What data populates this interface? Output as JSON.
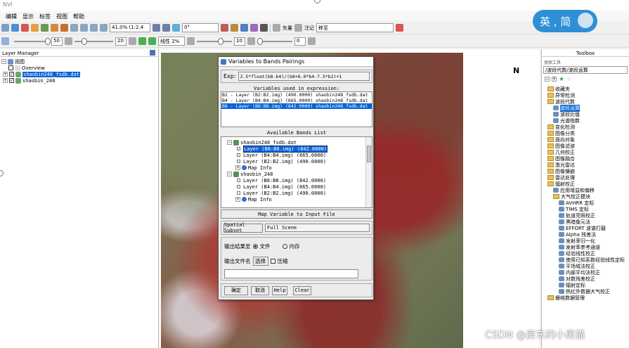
{
  "window": {
    "title": "NVI"
  },
  "menu": [
    "编辑",
    "显示",
    "标签",
    "视图",
    "帮助"
  ],
  "toolbar1": {
    "zoom": "41.0% (1:2.4",
    "rotation": "0°",
    "vector_label": "矢量",
    "annotation_label": "注记",
    "annotation_value": "移至"
  },
  "toolbar2": {
    "v1": "50",
    "v2": "20",
    "stretch": "线性 2%",
    "v3": "10",
    "v4": "0"
  },
  "ime": {
    "label": "英 , 简"
  },
  "layer_manager": {
    "title": "Layer Manager",
    "root": "视图",
    "items": [
      "Overview",
      "shaobin248_fsdb.dat",
      "shaobin_248"
    ]
  },
  "north_arrow": "N",
  "toolbox": {
    "title": "Toolbox",
    "path": "/波段代数/波段运算",
    "search_label": "搜索工具",
    "items": [
      {
        "label": "收藏夹",
        "level": 0,
        "icon": "folder"
      },
      {
        "label": "异常检测",
        "level": 0,
        "icon": "folder"
      },
      {
        "label": "波段代数",
        "level": 0,
        "icon": "folder"
      },
      {
        "label": "波段运算",
        "level": 1,
        "icon": "tool",
        "selected": true
      },
      {
        "label": "波段比值",
        "level": 1,
        "icon": "tool"
      },
      {
        "label": "光谱指数",
        "level": 1,
        "icon": "tool"
      },
      {
        "label": "变化检测",
        "level": 0,
        "icon": "folder"
      },
      {
        "label": "图像分类",
        "level": 0,
        "icon": "folder"
      },
      {
        "label": "面向对象",
        "level": 0,
        "icon": "folder"
      },
      {
        "label": "图像滤波",
        "level": 0,
        "icon": "folder"
      },
      {
        "label": "几何校正",
        "level": 0,
        "icon": "folder"
      },
      {
        "label": "图像融合",
        "level": 0,
        "icon": "folder"
      },
      {
        "label": "激光雷达",
        "level": 0,
        "icon": "folder"
      },
      {
        "label": "图像镶嵌",
        "level": 0,
        "icon": "folder"
      },
      {
        "label": "雷达处理",
        "level": 0,
        "icon": "folder"
      },
      {
        "label": "辐射校正",
        "level": 0,
        "icon": "folder"
      },
      {
        "label": "应用增益和偏移",
        "level": 1,
        "icon": "tool"
      },
      {
        "label": "大气校正模块",
        "level": 1,
        "icon": "folder"
      },
      {
        "label": "AVHRR 定标",
        "level": 2,
        "icon": "tool"
      },
      {
        "label": "TIMS 定标",
        "level": 2,
        "icon": "tool"
      },
      {
        "label": "轨道亮照校正",
        "level": 2,
        "icon": "tool"
      },
      {
        "label": "黑暗像元法",
        "level": 2,
        "icon": "tool"
      },
      {
        "label": "EFFORT 波谱打磨",
        "level": 2,
        "icon": "tool"
      },
      {
        "label": "Alpha 残差法",
        "level": 2,
        "icon": "tool"
      },
      {
        "label": "发射率归一化",
        "level": 2,
        "icon": "tool"
      },
      {
        "label": "发射率参考通道",
        "level": 2,
        "icon": "tool"
      },
      {
        "label": "经验线性校正",
        "level": 2,
        "icon": "tool"
      },
      {
        "label": "使用已知系数经验线性定标",
        "level": 2,
        "icon": "tool"
      },
      {
        "label": "平场域法校正",
        "level": 2,
        "icon": "tool"
      },
      {
        "label": "内部平均法校正",
        "level": 2,
        "icon": "tool"
      },
      {
        "label": "对数残差校正",
        "level": 2,
        "icon": "tool"
      },
      {
        "label": "辐射定标",
        "level": 2,
        "icon": "tool"
      },
      {
        "label": "热红外数据大气校正",
        "level": 2,
        "icon": "tool"
      },
      {
        "label": "栅格数据管理",
        "level": 0,
        "icon": "folder"
      }
    ]
  },
  "dialog": {
    "title": "Variables to Bands Pairings",
    "exp_label": "Exp:",
    "expression": "2.5*float(b8-b4)/(b8+6.0*b4-7.5*b2)+1",
    "variables_title": "Variables used in expression:",
    "variables": [
      "B2 - Layer (B2:B2.img) (490.0000) shaobin248_fsdb.dat",
      "B4 - Layer (B4:B4.img) (665.0000) shaobin248_fsdb.dat",
      "B8 - Layer (B8:B8.img) (842.0000) shaobin248_fsdb.dat"
    ],
    "selected_variable": 2,
    "available_title": "Available Bands List",
    "tree": [
      {
        "label": "shaobin248_fsdb.dat",
        "level": 0,
        "type": "file"
      },
      {
        "label": "Layer (B8:B8.img) (842.0000)",
        "level": 1,
        "type": "band",
        "selected": true
      },
      {
        "label": "Layer (B4:B4.img) (665.0000)",
        "level": 1,
        "type": "band"
      },
      {
        "label": "Layer (B2:B2.img) (490.0000)",
        "level": 1,
        "type": "band"
      },
      {
        "label": "Map Info",
        "level": 1,
        "type": "map"
      },
      {
        "label": "shaobin_248",
        "level": 0,
        "type": "file"
      },
      {
        "label": "Layer (B8:B8.img) (842.0000)",
        "level": 1,
        "type": "band"
      },
      {
        "label": "Layer (B4:B4.img) (665.0000)",
        "level": 1,
        "type": "band"
      },
      {
        "label": "Layer (B2:B2.img) (490.0000)",
        "level": 1,
        "type": "band"
      },
      {
        "label": "Map Info",
        "level": 1,
        "type": "map"
      }
    ],
    "map_button": "Map Variable to Input File",
    "spatial_subset_button": "Spatial Subset",
    "spatial_subset_value": "Full Scene",
    "output_to_label": "输出结果至",
    "output_file_option": "文件",
    "output_memory_option": "内存",
    "output_name_label": "输出文件名",
    "choose_button": "选择",
    "compress_label": "压缩",
    "ok": "确定",
    "cancel": "取消",
    "help": "Help",
    "clear": "Clear"
  },
  "watermark": "CSDN @房东的小黑猫"
}
